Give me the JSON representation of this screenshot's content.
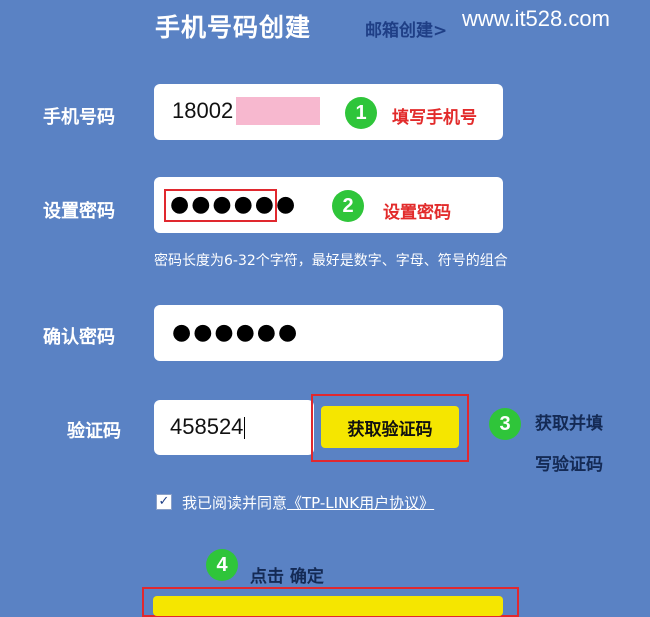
{
  "header": {
    "title": "手机号码创建",
    "email_link": "邮箱创建>",
    "watermark": "www.it528.com"
  },
  "phone": {
    "label": "手机号码",
    "value": "18002",
    "redacted": true,
    "redaction_color": "#f7b8cf",
    "step": "1",
    "annotation": "填写手机号"
  },
  "password": {
    "label": "设置密码",
    "value": "●●●●●●",
    "step": "2",
    "annotation": "设置密码",
    "hint": "密码长度为6-32个字符，最好是数字、字母、符号的组合"
  },
  "confirm": {
    "label": "确认密码",
    "value": "●●●●●●"
  },
  "captcha": {
    "label": "验证码",
    "value": "458524",
    "button": "获取验证码",
    "step": "3",
    "annotation_line1": "获取并填",
    "annotation_line2": "写验证码"
  },
  "agreement": {
    "checked": true,
    "check_mark": "✓",
    "text": "我已阅读并同意",
    "link": "《TP-LINK用户协议》"
  },
  "confirm_step": {
    "step": "4",
    "annotation": "点击 确定"
  },
  "colors": {
    "background": "#5a82c4",
    "badge": "#2fc53a",
    "highlight": "#e0282e",
    "button": "#f5e600"
  }
}
